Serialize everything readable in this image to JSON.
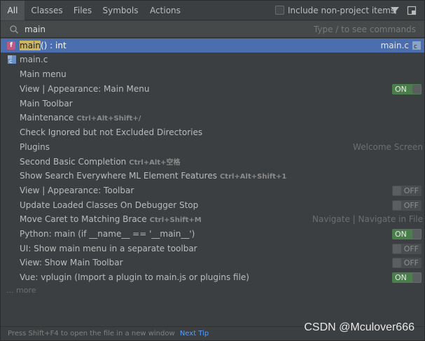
{
  "tabs": [
    {
      "label": "All"
    },
    {
      "label": "Classes"
    },
    {
      "label": "Files"
    },
    {
      "label": "Symbols"
    },
    {
      "label": "Actions"
    }
  ],
  "include_label": "Include non-project items",
  "search": {
    "value": "main",
    "hint": "Type / to see commands"
  },
  "results": [
    {
      "pre": "",
      "match": "main",
      "post": "() : int",
      "right": "main.c",
      "icon": "function-icon",
      "selected": true
    },
    {
      "label": "main.c",
      "icon": "c-file-icon"
    },
    {
      "label": "Main menu"
    },
    {
      "label": "View | Appearance: Main Menu",
      "toggle": "ON"
    },
    {
      "label": "Main Toolbar"
    },
    {
      "label": "Maintenance",
      "shortcut": "Ctrl+Alt+Shift+/"
    },
    {
      "label": "Check Ignored but not Excluded Directories"
    },
    {
      "label": "Plugins",
      "right": "Welcome Screen"
    },
    {
      "label": "Second Basic Completion",
      "shortcut": "Ctrl+Alt+空格"
    },
    {
      "label": "Show Search Everywhere ML Element Features",
      "shortcut": "Ctrl+Alt+Shift+1"
    },
    {
      "label": "View | Appearance: Toolbar",
      "toggle": "OFF"
    },
    {
      "label": "Update Loaded Classes On Debugger Stop",
      "toggle": "OFF"
    },
    {
      "label": "Move Caret to Matching Brace",
      "shortcut": "Ctrl+Shift+M",
      "right": "Navigate | Navigate in File"
    },
    {
      "label": "Python: main (if __name__ == '__main__')",
      "toggle": "ON"
    },
    {
      "label": "UI: Show main menu in a separate toolbar",
      "toggle": "OFF"
    },
    {
      "label": "View: Show Main Toolbar",
      "toggle": "OFF"
    },
    {
      "label": "Vue: vplugin (Import a plugin to main.js or plugins file)",
      "toggle": "ON"
    }
  ],
  "more_label": "... more",
  "status": {
    "text": "Press Shift+F4 to open the file in a new window",
    "next_tip": "Next Tip"
  },
  "watermark": "CSDN @Mculover666",
  "colors": {
    "selection": "#4b6eaf",
    "toggle_on": "#4c7d4c",
    "match_highlight": "#cdb65f",
    "function_icon": "#c0597f"
  }
}
